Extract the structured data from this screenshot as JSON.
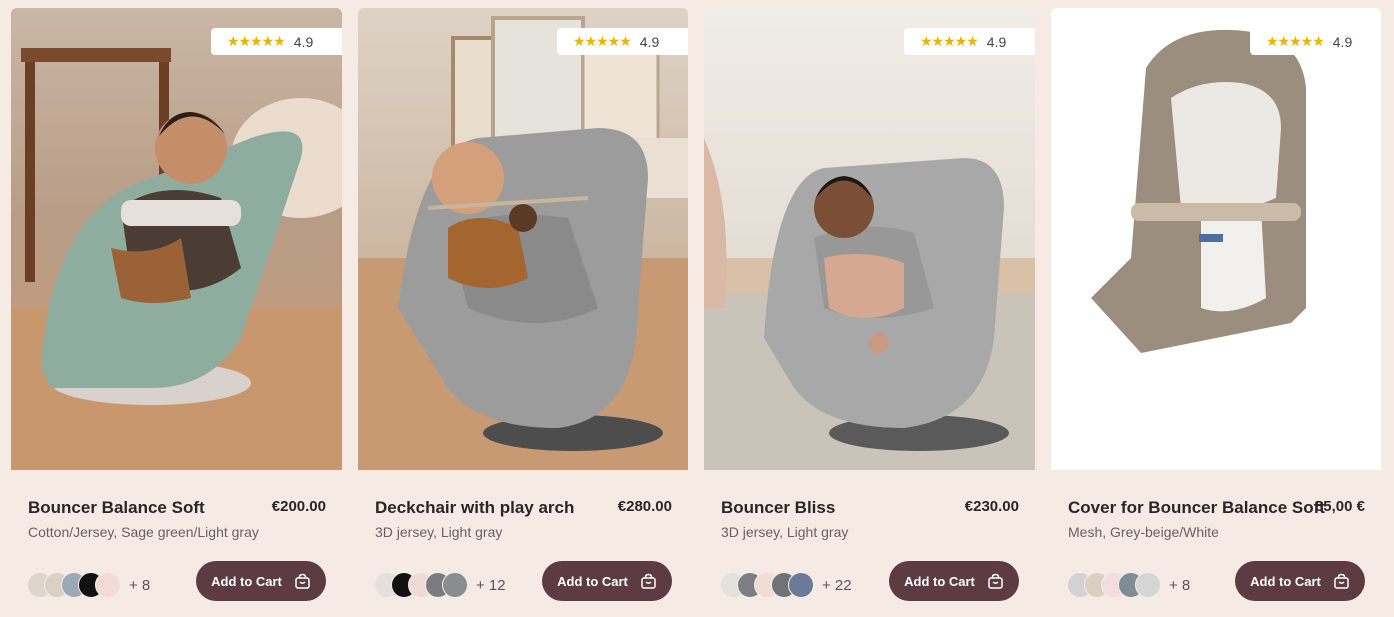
{
  "products": [
    {
      "rating": "4.9",
      "stars": "★★★★★",
      "title": "Bouncer Balance Soft",
      "price": "€200.00",
      "subtitle": "Cotton/Jersey, Sage green/Light gray",
      "swatches": [
        "#dcd6cc",
        "#d8d1c4",
        "#9aa9b5",
        "#111111",
        "#f3dcd8"
      ],
      "more_colors": "+ 8",
      "cta": "Add to Cart",
      "image_icon": "baby-in-green-bouncer-photo"
    },
    {
      "rating": "4.9",
      "stars": "★★★★★",
      "title": "Deckchair with play arch",
      "price": "€280.00",
      "subtitle": "3D jersey, Light gray",
      "swatches": [
        "#e4e1dd",
        "#111111",
        "#f0dad6",
        "#7a7c7f",
        "#8a8c8f"
      ],
      "more_colors": "+ 12",
      "cta": "Add to Cart",
      "image_icon": "baby-in-grey-bouncer-with-toy-photo"
    },
    {
      "rating": "4.9",
      "stars": "★★★★★",
      "title": "Bouncer Bliss",
      "price": "€230.00",
      "subtitle": "3D jersey, Light gray",
      "swatches": [
        "#e3e1de",
        "#7c7f82",
        "#f2dcd6",
        "#6f7378",
        "#6b7a99"
      ],
      "more_colors": "+ 22",
      "cta": "Add to Cart",
      "image_icon": "baby-in-light-grey-bouncer-photo"
    },
    {
      "rating": "4.9",
      "stars": "★★★★★",
      "title": "Cover for Bouncer Balance Soft",
      "price": "85,00 €",
      "subtitle": "Mesh, Grey-beige/White",
      "swatches": [
        "#d3d3d3",
        "#d9d0c2",
        "#f3dde0",
        "#7f8c95",
        "#d5d5d5"
      ],
      "more_colors": "+ 8",
      "cta": "Add to Cart",
      "image_icon": "mesh-bouncer-cover-photo"
    }
  ],
  "colors": {
    "page_bg": "#f5ebe4",
    "button_bg": "#5c3b42",
    "star": "#e8b400"
  }
}
